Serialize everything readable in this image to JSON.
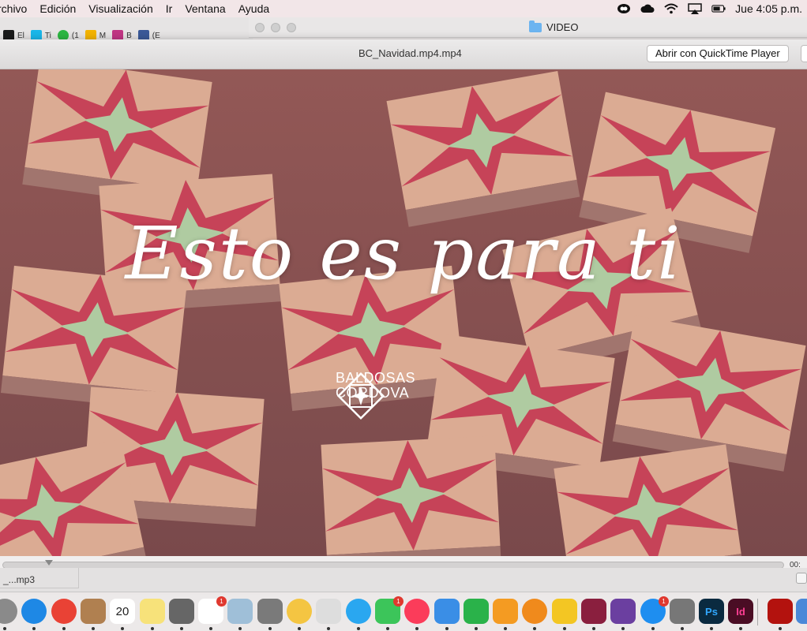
{
  "menubar": {
    "items": [
      "rchivo",
      "Edición",
      "Visualización",
      "Ir",
      "Ventana",
      "Ayuda"
    ],
    "clock": "Jue 4:05 p.m."
  },
  "browser": {
    "bookmarks": [
      {
        "label": "El",
        "icon": "IS",
        "color": "#1a1a1a"
      },
      {
        "label": "Ti",
        "icon": "v",
        "color": "#1ab7ea"
      },
      {
        "label": "(1",
        "icon": "1",
        "color": "#2cb742"
      },
      {
        "label": "M",
        "icon": "drive",
        "color": "#f4b400"
      },
      {
        "label": "B",
        "icon": "ig",
        "color": "#c13584"
      },
      {
        "label": "(E",
        "icon": "f",
        "color": "#3b5998"
      }
    ]
  },
  "finder": {
    "title": "VIDEO"
  },
  "quicklook": {
    "title": "BC_Navidad.mp4.mp4",
    "open_button": "Abrir con QuickTime Player",
    "headline": "Esto es para ti",
    "logo_line1": "BALDOSAS",
    "logo_line2": "CORDOVA",
    "progress": 0.06,
    "timecode": "00:"
  },
  "lower": {
    "tab_label": "_...mp3"
  },
  "dock": {
    "items": [
      {
        "name": "system-icon",
        "label": "",
        "color": "#8a8a8a"
      },
      {
        "name": "safari-icon",
        "label": "",
        "color": "#1e88e5"
      },
      {
        "name": "chrome-icon",
        "label": "",
        "color": "#e94235"
      },
      {
        "name": "contacts-icon",
        "label": "",
        "color": "#b08050"
      },
      {
        "name": "calendar-icon",
        "label": "20",
        "color": "#ffffff"
      },
      {
        "name": "notes-icon",
        "label": "",
        "color": "#f7e27a"
      },
      {
        "name": "calculator-icon",
        "label": "",
        "color": "#666666"
      },
      {
        "name": "reminders-icon",
        "label": "",
        "color": "#ffffff",
        "badge": "1"
      },
      {
        "name": "preview-icon",
        "label": "",
        "color": "#9fbfd8"
      },
      {
        "name": "screenshot-icon",
        "label": "",
        "color": "#7a7a7a"
      },
      {
        "name": "photos-icon",
        "label": "",
        "color": "#f4c542"
      },
      {
        "name": "scissors-icon",
        "label": "",
        "color": "#dddddd"
      },
      {
        "name": "messages-icon",
        "label": "",
        "color": "#2aa7f0"
      },
      {
        "name": "facetime-icon",
        "label": "",
        "color": "#3cc55a",
        "badge": "1"
      },
      {
        "name": "music-icon",
        "label": "",
        "color": "#fb3c5a"
      },
      {
        "name": "keynote-icon",
        "label": "",
        "color": "#3a8ee6"
      },
      {
        "name": "numbers-icon",
        "label": "",
        "color": "#2ab24a"
      },
      {
        "name": "pages-icon",
        "label": "",
        "color": "#f49b22"
      },
      {
        "name": "books-icon",
        "label": "",
        "color": "#f08a1c"
      },
      {
        "name": "cyberduck-icon",
        "label": "",
        "color": "#f3c623"
      },
      {
        "name": "design-icon",
        "label": "",
        "color": "#8a1f3e"
      },
      {
        "name": "imovie-icon",
        "label": "",
        "color": "#6b3fa0"
      },
      {
        "name": "appstore-icon",
        "label": "",
        "color": "#1e8ef0",
        "badge": "1"
      },
      {
        "name": "preferences-icon",
        "label": "",
        "color": "#777777"
      },
      {
        "name": "photoshop-icon",
        "label": "Ps",
        "color": "#0a2a40"
      },
      {
        "name": "indesign-icon",
        "label": "Id",
        "color": "#4a0d24"
      },
      {
        "name": "acrobat-icon",
        "label": "",
        "color": "#b3120e"
      },
      {
        "name": "finder-doc-icon",
        "label": "",
        "color": "#4a88d8"
      }
    ]
  }
}
